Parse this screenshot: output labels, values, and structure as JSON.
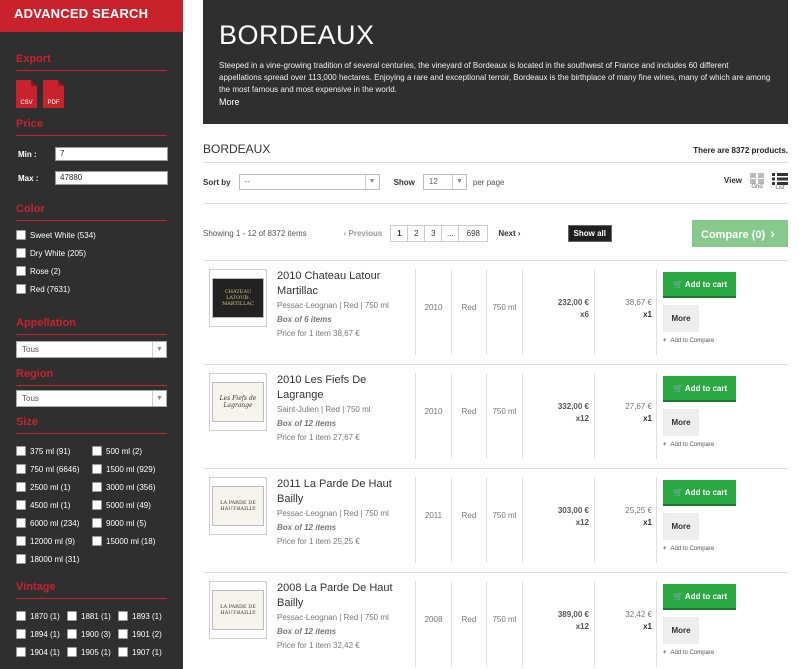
{
  "sidebar": {
    "title": "ADVANCED SEARCH",
    "export": {
      "title": "Export",
      "files": [
        "CSV",
        "PDF"
      ]
    },
    "price": {
      "title": "Price",
      "min_label": "Min :",
      "min_value": "7",
      "max_label": "Max :",
      "max_value": "47880"
    },
    "color": {
      "title": "Color",
      "options": [
        "Sweet White (534)",
        "Dry White (205)",
        "Rose (2)",
        "Red (7631)"
      ]
    },
    "appellation": {
      "title": "Appellation",
      "value": "Tous"
    },
    "region": {
      "title": "Region",
      "value": "Tous"
    },
    "size": {
      "title": "Size",
      "options": [
        "375 ml (91)",
        "500 ml (2)",
        "750 ml (6646)",
        "1500 ml (929)",
        "2500 ml (1)",
        "3000 ml (356)",
        "4500 ml (1)",
        "5000 ml (49)",
        "6000 ml (234)",
        "9000 ml (5)",
        "12000 ml (9)",
        "15000 ml (18)",
        "18000 ml (31)"
      ]
    },
    "vintage": {
      "title": "Vintage",
      "options": [
        "1870 (1)",
        "1881 (1)",
        "1893 (1)",
        "1894 (1)",
        "1900 (3)",
        "1901 (2)",
        "1904 (1)",
        "1905 (1)",
        "1907 (1)"
      ]
    }
  },
  "banner": {
    "title": "BORDEAUX",
    "text": "Steeped in a vine-growing tradition of several centuries, the vineyard of Bordeaux is located in the southwest of France and includes 60 different appellations spread over 113,000 hectares. Enjoying a rare and exceptional terroir, Bordeaux is the birthplace of many fine wines, many of which are among the most famous and most expensive in the world.",
    "more": "More"
  },
  "category": {
    "title": "BORDEAUX",
    "count_text": "There are 8372 products."
  },
  "toolbar": {
    "sort_label": "Sort by",
    "sort_value": "--",
    "show_label": "Show",
    "show_value": "12",
    "per_page": "per page",
    "view_label": "View",
    "grid": "Grid",
    "list": "List"
  },
  "pagination": {
    "showing": "Showing 1 - 12 of 8372 items",
    "previous": "Previous",
    "pages": [
      "1",
      "2",
      "3",
      "...",
      "698"
    ],
    "next": "Next",
    "show_all": "Show all",
    "compare": "Compare (0)"
  },
  "products": [
    {
      "name": "2010 Chateau Latour Martillac",
      "meta": "Pessac-Leognan | Red | 750 ml",
      "box": "Box of 6 items",
      "unit_price": "Price for 1 item 38,67 €",
      "year": "2010",
      "color": "Red",
      "volume": "750 ml",
      "price": "232,00 €",
      "qty": "x6",
      "unit": "38,67 €",
      "unit_qty": "x1",
      "label_text": "CHATEAU LATOUR-MARTILLAC"
    },
    {
      "name": "2010 Les Fiefs De Lagrange",
      "meta": "Saint-Julien | Red | 750 ml",
      "box": "Box of 12 items",
      "unit_price": "Price for 1 item 27,67 €",
      "year": "2010",
      "color": "Red",
      "volume": "750 ml",
      "price": "332,00 €",
      "qty": "x12",
      "unit": "27,67 €",
      "unit_qty": "x1",
      "label_text": "Les Fiefs de Lagrange"
    },
    {
      "name": "2011 La Parde De Haut Bailly",
      "meta": "Pessac-Leognan | Red | 750 ml",
      "box": "Box of 12 items",
      "unit_price": "Price for 1 item 25,25 €",
      "year": "2011",
      "color": "Red",
      "volume": "750 ml",
      "price": "303,00 €",
      "qty": "x12",
      "unit": "25,25 €",
      "unit_qty": "x1",
      "label_text": "LA PARDE DE HAUT-BAILLY"
    },
    {
      "name": "2008 La Parde De Haut Bailly",
      "meta": "Pessac-Leognan | Red | 750 ml",
      "box": "Box of 12 items",
      "unit_price": "Price for 1 item 32,42 €",
      "year": "2008",
      "color": "Red",
      "volume": "750 ml",
      "price": "389,00 €",
      "qty": "x12",
      "unit": "32,42 €",
      "unit_qty": "x1",
      "label_text": "LA PARDE DE HAUT-BAILLY"
    }
  ],
  "actions": {
    "add_to_cart": "Add to cart",
    "more": "More",
    "add_to_compare": "Add to Compare"
  }
}
